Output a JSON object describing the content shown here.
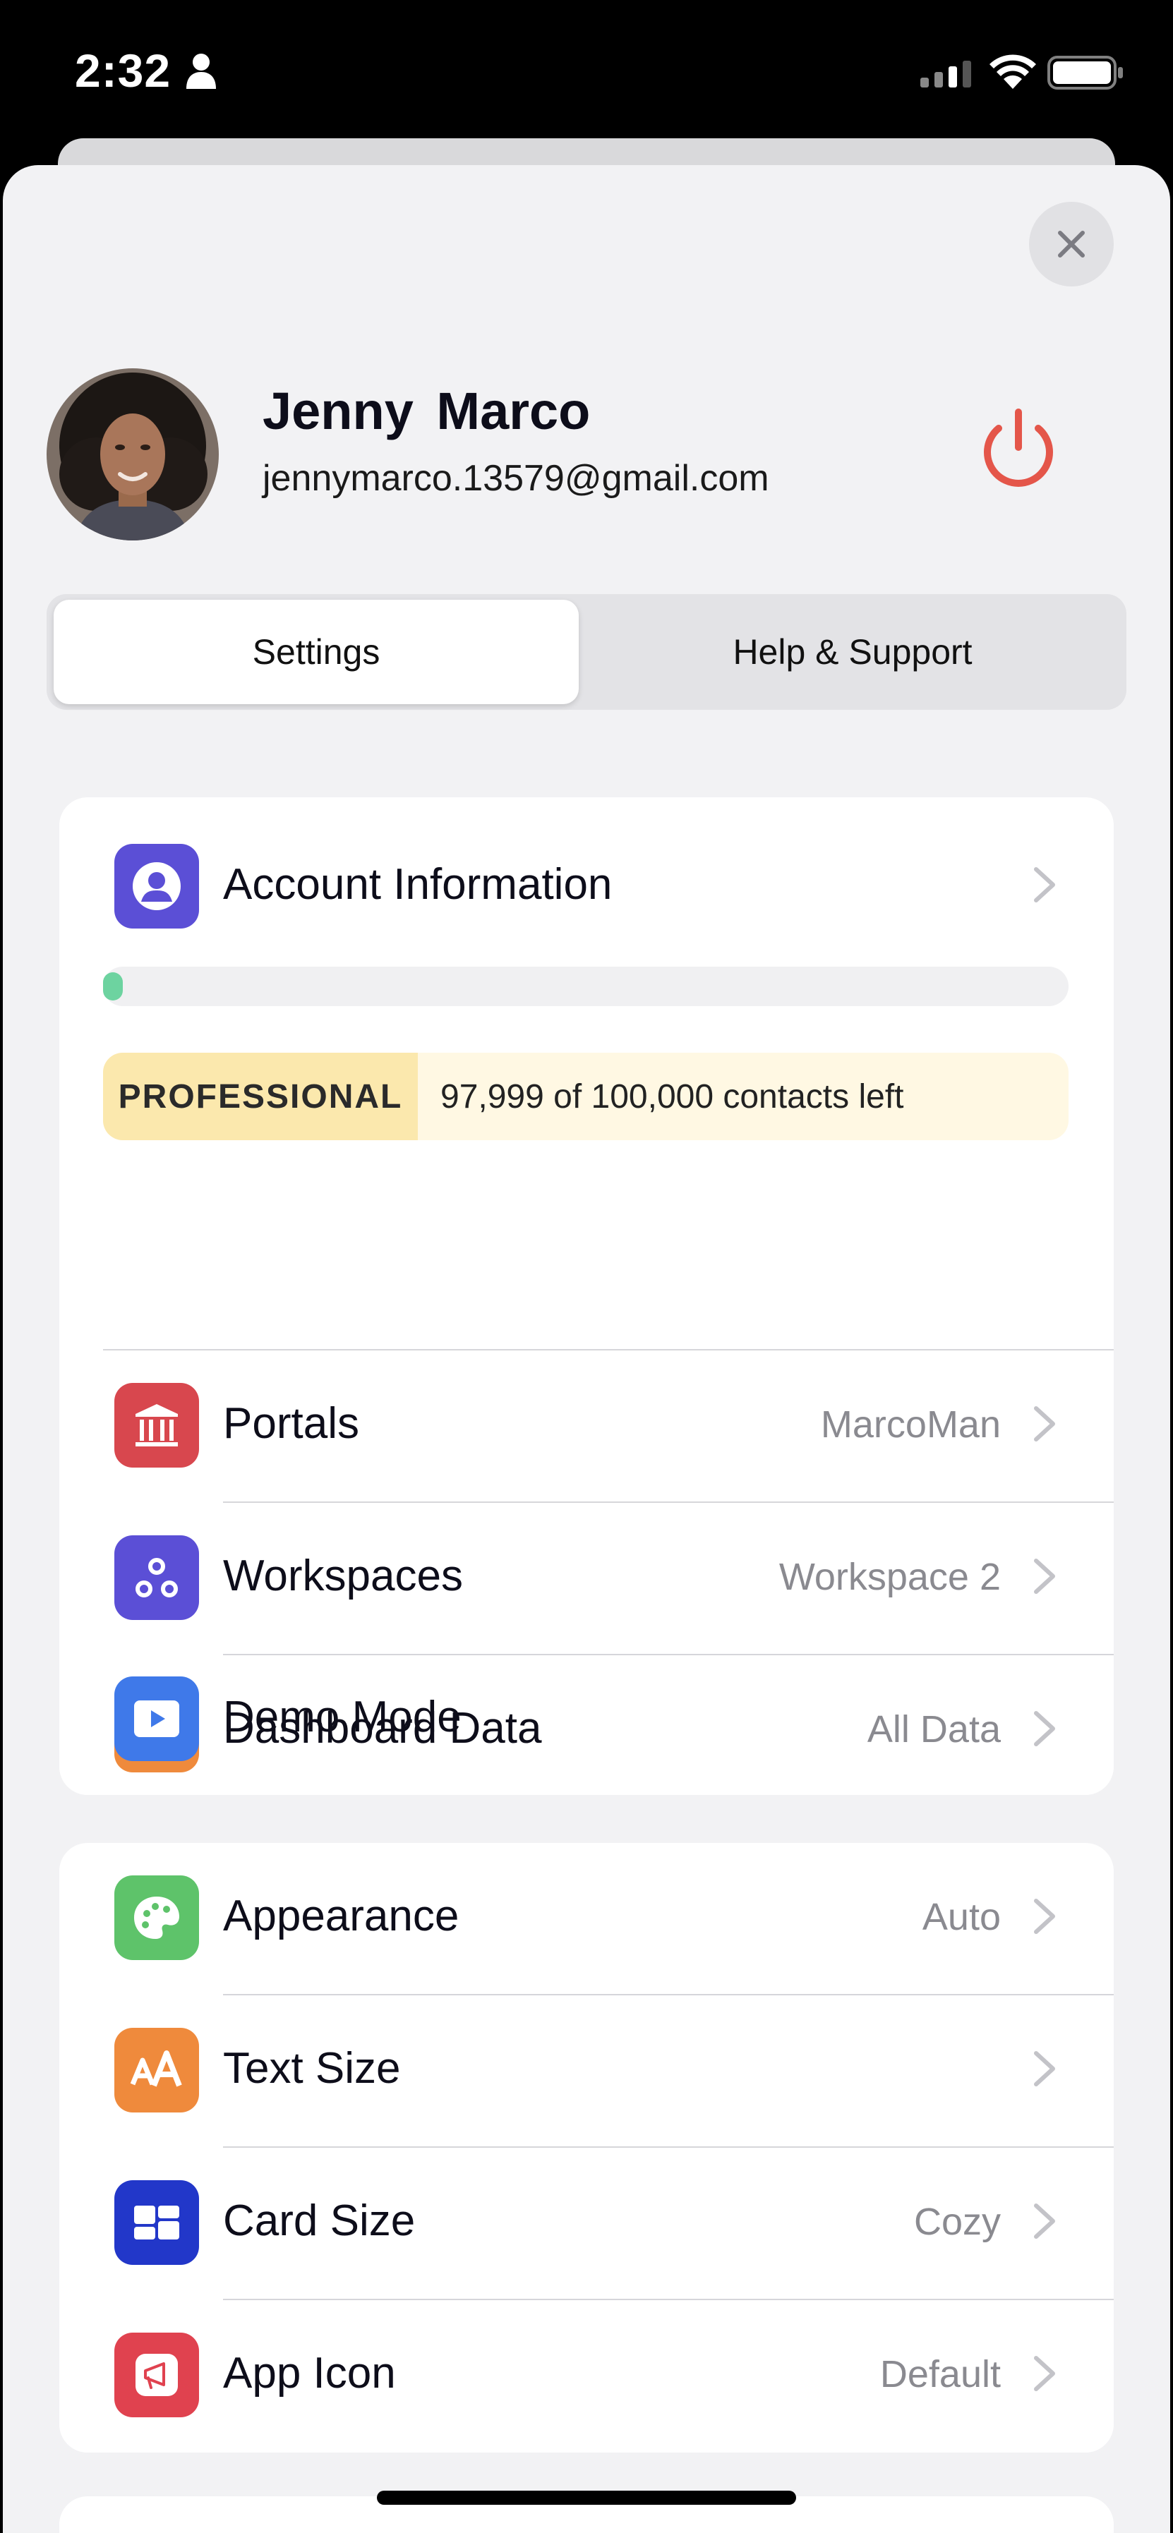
{
  "status_bar": {
    "time": "2:32"
  },
  "profile": {
    "name": "Jenny  Marco",
    "email": "jennymarco.13579@gmail.com"
  },
  "tabs": [
    {
      "label": "Settings",
      "active": true
    },
    {
      "label": "Help & Support",
      "active": false
    }
  ],
  "account": {
    "label": "Account Information",
    "progress": 0.0001,
    "plan": "PROFESSIONAL",
    "contacts_left": "97,999 of 100,000 contacts left"
  },
  "data_rows": [
    {
      "label": "Portals",
      "value": "MarcoMan",
      "icon": "bank-icon",
      "color": "#d8474e"
    },
    {
      "label": "Workspaces",
      "value": "Workspace 2",
      "icon": "workspaces-icon",
      "color": "#5b4fd6"
    },
    {
      "label": "Dashboard Data",
      "value": "All Data",
      "icon": "box-icon",
      "color": "#ef8a3c"
    },
    {
      "label": "Demo Mode",
      "value": "",
      "icon": "play-icon",
      "color": "#3f79e9"
    }
  ],
  "display_rows": [
    {
      "label": "Appearance",
      "value": "Auto",
      "icon": "palette-icon",
      "color": "#5ec36a"
    },
    {
      "label": "Text Size",
      "value": "",
      "icon": "text-size-icon",
      "color": "#ef8a3c"
    },
    {
      "label": "Card Size",
      "value": "Cozy",
      "icon": "cards-icon",
      "color": "#2237c9"
    },
    {
      "label": "App Icon",
      "value": "Default",
      "icon": "app-icon-icon",
      "color": "#e0424f"
    }
  ],
  "colors": {
    "accent_power": "#e4564a",
    "progress": "#6dd3a0",
    "plan_badge_bg": "#fbe8ad",
    "plan_bg": "#fff8e3"
  }
}
